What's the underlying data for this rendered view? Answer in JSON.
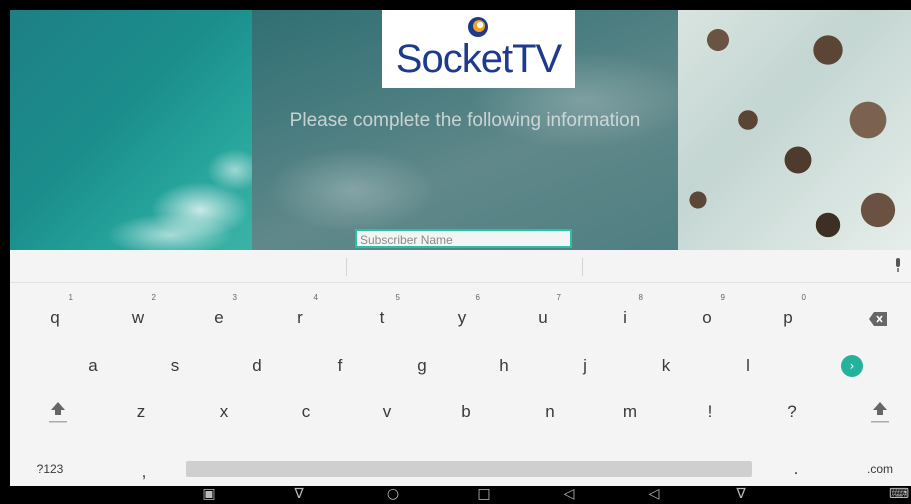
{
  "logo": {
    "brand_part1": "Socket",
    "brand_part2": "TV",
    "colors": {
      "brand": "#1d3a8c",
      "accent": "#f2a21b"
    }
  },
  "form": {
    "prompt": "Please complete the following information",
    "subscriber_field": {
      "placeholder": "Subscriber Name",
      "value": ""
    }
  },
  "keyboard": {
    "row1": [
      {
        "label": "q",
        "hint": "1"
      },
      {
        "label": "w",
        "hint": "2"
      },
      {
        "label": "e",
        "hint": "3"
      },
      {
        "label": "r",
        "hint": "4"
      },
      {
        "label": "t",
        "hint": "5"
      },
      {
        "label": "y",
        "hint": "6"
      },
      {
        "label": "u",
        "hint": "7"
      },
      {
        "label": "i",
        "hint": "8"
      },
      {
        "label": "o",
        "hint": "9"
      },
      {
        "label": "p",
        "hint": "0"
      }
    ],
    "row2": [
      "a",
      "s",
      "d",
      "f",
      "g",
      "h",
      "j",
      "k",
      "l"
    ],
    "row3": [
      "z",
      "x",
      "c",
      "v",
      "b",
      "n",
      "m",
      "!",
      "?"
    ],
    "symbols_key": "?123",
    "comma_key": ",",
    "period_key": ".",
    "dotcom_key": ".com",
    "icons": {
      "backspace": "backspace-icon",
      "enter": "go-icon",
      "shift": "shift-icon",
      "mic": "mic-icon"
    },
    "accent_color": "#24b39a"
  },
  "navbar": {
    "icons": [
      "screenshot-icon",
      "volume-down-nav-icon",
      "home-icon",
      "recents-icon",
      "volume-down-icon",
      "volume-up-icon",
      "back-icon",
      "keyboard-switch-icon"
    ]
  }
}
